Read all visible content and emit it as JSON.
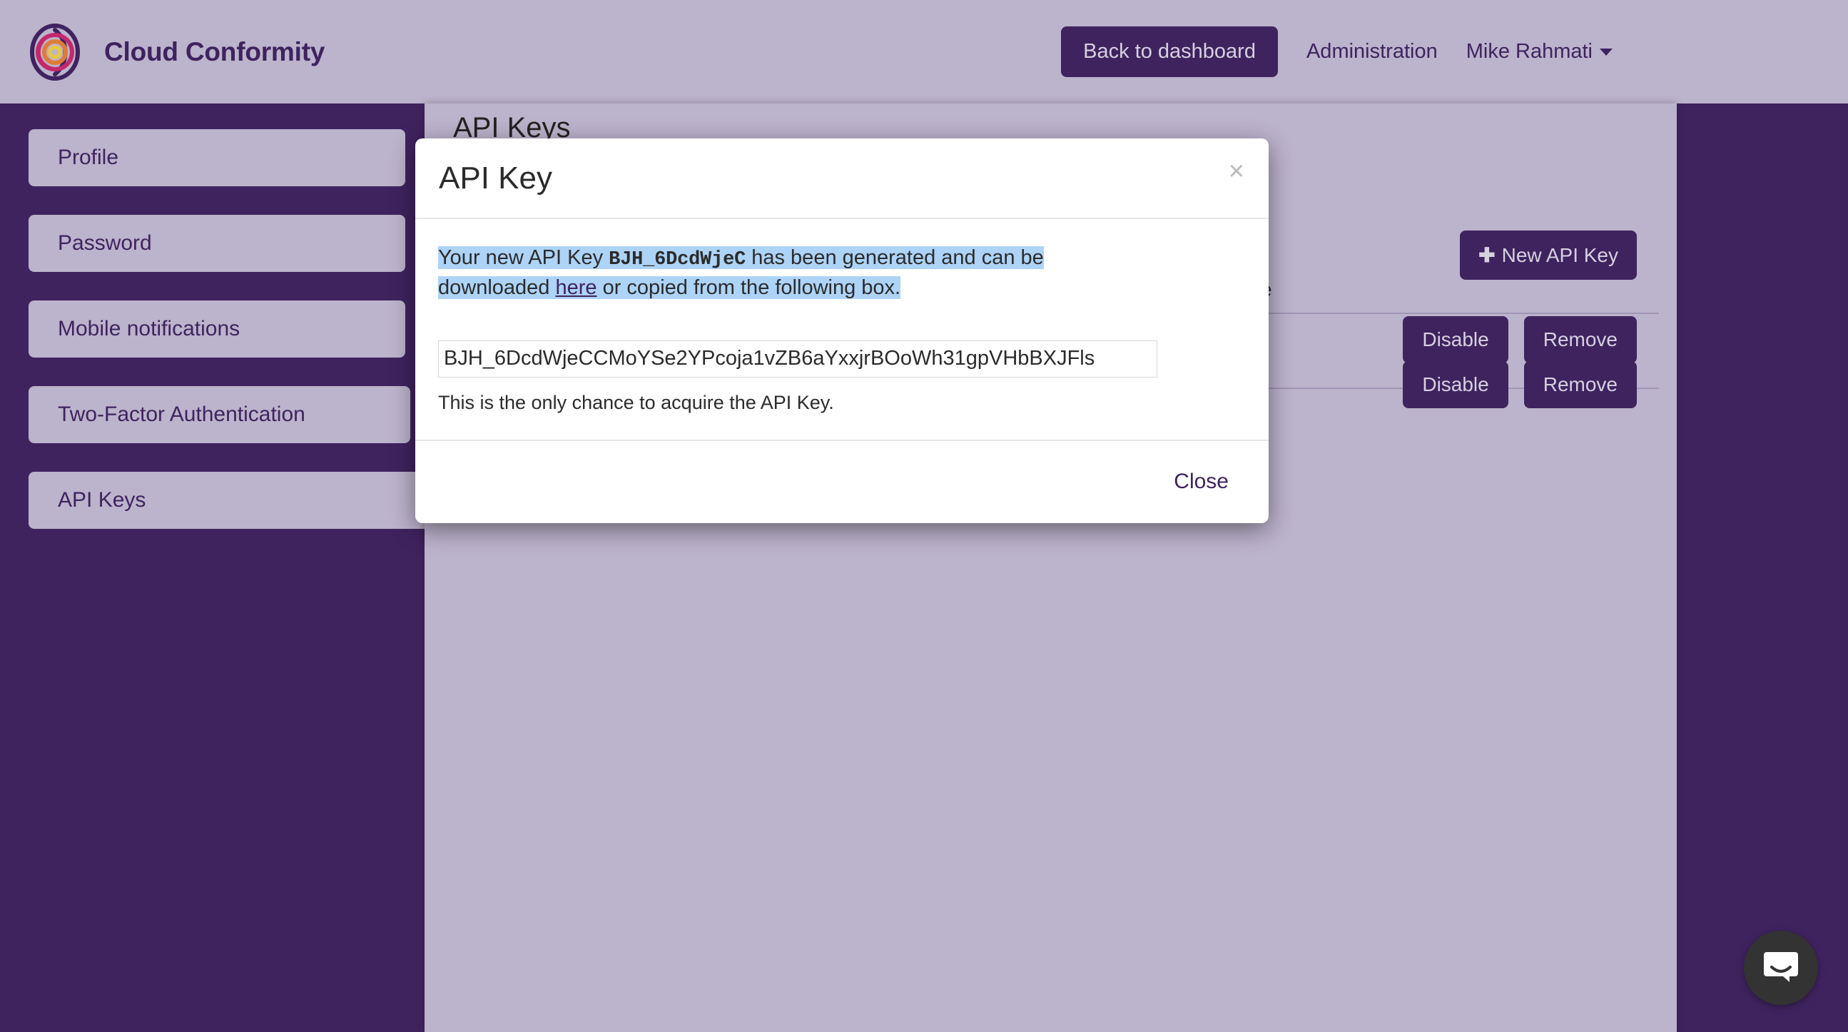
{
  "header": {
    "brand_name": "Cloud Conformity",
    "logo_icon": "cloud-conformity-logo",
    "dashboard_button": "Back to dashboard",
    "administration_link": "Administration",
    "user_name": "Mike Rahmati",
    "caret_icon": "chevron-down-icon"
  },
  "sidebar": {
    "items": [
      {
        "label": "Profile"
      },
      {
        "label": "Password"
      },
      {
        "label": "Mobile notifications"
      },
      {
        "label": "Two-Factor Authentication"
      },
      {
        "label": "API Keys"
      }
    ]
  },
  "main": {
    "page_title": "API Keys",
    "new_key_button": "New API Key",
    "plus_icon": "plus-icon",
    "column_header_partial": "e",
    "rows": [
      {
        "disable_label": "Disable",
        "remove_label": "Remove"
      },
      {
        "disable_label": "Disable",
        "remove_label": "Remove"
      }
    ]
  },
  "modal": {
    "title": "API Key",
    "close_icon": "close-icon",
    "message_part1": "Your new API Key ",
    "message_key": "BJH_6DcdWjeC",
    "message_part2": " has been generated and can be downloaded ",
    "message_link": "here",
    "message_part3": " or copied from the following box.",
    "api_key_value": "BJH_6DcdWjeCCMoYSe2YPcoja1vZB6aYxxjrBOoWh31gpVHbBXJFls",
    "note": "This is the only chance to acquire the API Key.",
    "close_button": "Close"
  },
  "chat": {
    "launcher_icon": "chat-bubble-icon"
  },
  "colors": {
    "brand_purple": "#3F235F",
    "lavender": "#BCB3CC",
    "selection_blue": "#ADD3F7",
    "chat_dark": "#333333"
  }
}
